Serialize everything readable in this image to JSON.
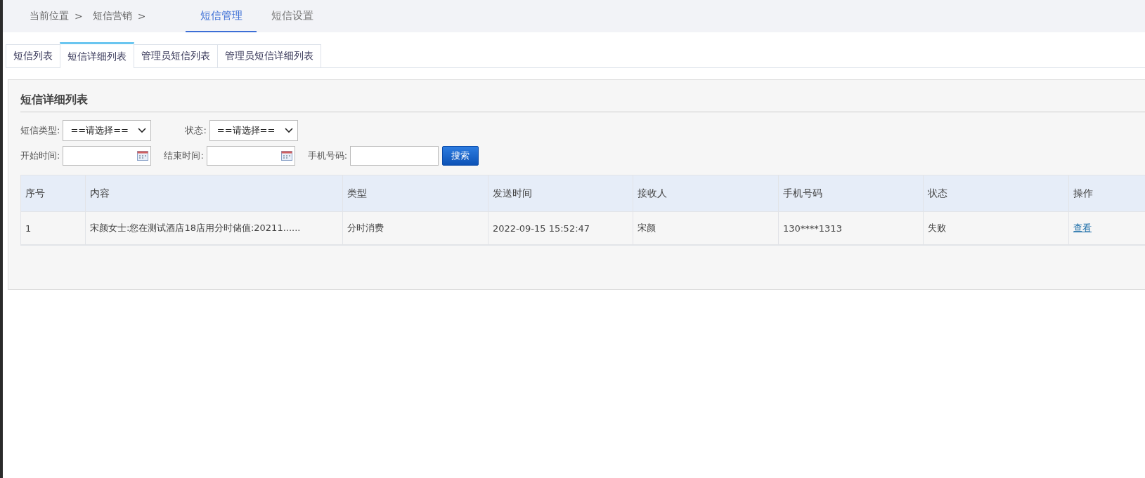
{
  "breadcrumb": {
    "items": [
      "当前位置",
      "短信营销"
    ],
    "separator": ">"
  },
  "top_tabs": [
    {
      "label": "短信管理",
      "selected": true
    },
    {
      "label": "短信设置",
      "selected": false
    }
  ],
  "sub_tabs": [
    {
      "label": "短信列表",
      "selected": false
    },
    {
      "label": "短信详细列表",
      "selected": true
    },
    {
      "label": "管理员短信列表",
      "selected": false
    },
    {
      "label": "管理员短信详细列表",
      "selected": false
    }
  ],
  "panel": {
    "title": "短信详细列表",
    "filters": [
      [
        {
          "kind": "select",
          "label": "短信类型:",
          "value": "==请选择=="
        },
        {
          "kind": "select",
          "label": "状态:",
          "value": "==请选择=="
        }
      ],
      [
        {
          "kind": "date",
          "label": "开始时间:"
        },
        {
          "kind": "date",
          "label": "结束时间:"
        },
        {
          "kind": "text",
          "label": "手机号码:"
        },
        {
          "kind": "button",
          "label": "搜索"
        }
      ]
    ],
    "table": {
      "columns": [
        "序号",
        "内容",
        "类型",
        "发送时间",
        "接收人",
        "手机号码",
        "状态",
        "操作"
      ],
      "rows": [
        {
          "cells": [
            "1",
            "宋颜女士:您在测试酒店18店用分时储值:20211......",
            "分时消费",
            "2022-09-15 15:52:47",
            "宋颜",
            "130****1313",
            "失败"
          ],
          "action": "查看"
        }
      ]
    }
  }
}
